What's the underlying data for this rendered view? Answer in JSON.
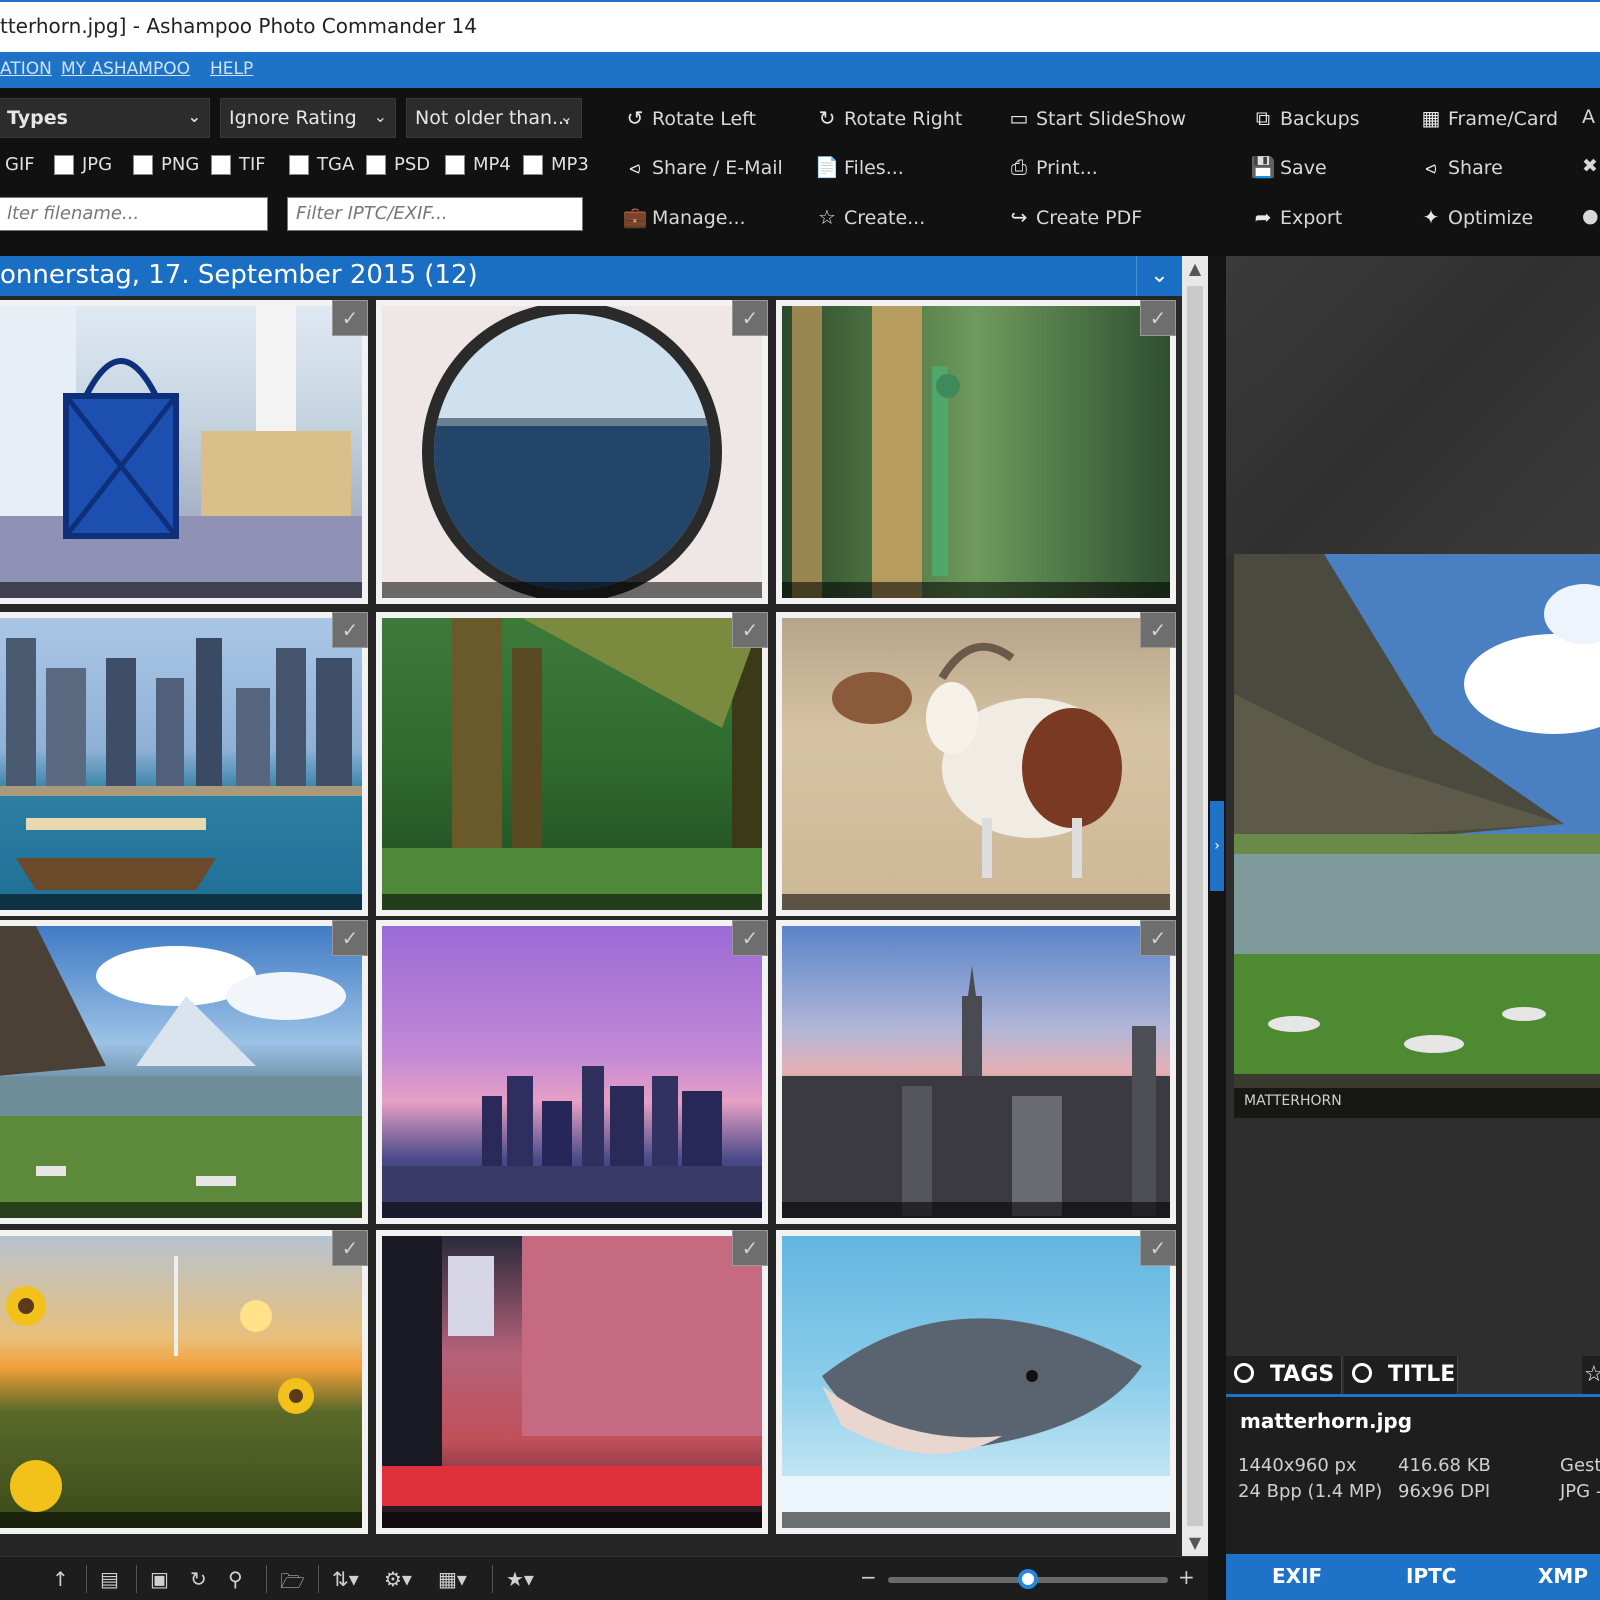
{
  "window": {
    "title": "tterhorn.jpg] - Ashampoo Photo Commander 14"
  },
  "menu": {
    "items": [
      "ATION",
      "MY ASHAMPOO",
      "HELP"
    ]
  },
  "filters": {
    "types": "Types",
    "rating": "Ignore Rating",
    "age": "Not older than...",
    "filetypes": [
      "GIF",
      "JPG",
      "PNG",
      "TIF",
      "TGA",
      "PSD",
      "MP4",
      "MP3"
    ],
    "filename_placeholder": "lter filename...",
    "iptc_placeholder": "Filter IPTC/EXIF..."
  },
  "toolbar": {
    "rotate_left": "Rotate Left",
    "rotate_right": "Rotate Right",
    "start_slideshow": "Start SlideShow",
    "share_email": "Share / E-Mail",
    "files": "Files...",
    "print": "Print...",
    "manage": "Manage...",
    "create": "Create...",
    "create_pdf": "Create PDF",
    "backups": "Backups",
    "frame_card": "Frame/Card",
    "save": "Save",
    "share": "Share",
    "export": "Export",
    "optimize": "Optimize"
  },
  "group": {
    "header": "onnerstag, 17. September 2015 (12)"
  },
  "thumbnails": [
    {
      "name": "lantern"
    },
    {
      "name": "porthole-sea"
    },
    {
      "name": "dragonfly"
    },
    {
      "name": "dubai-skyline"
    },
    {
      "name": "forest"
    },
    {
      "name": "goat"
    },
    {
      "name": "matterhorn"
    },
    {
      "name": "new-york-dusk"
    },
    {
      "name": "new-york-skyline"
    },
    {
      "name": "sunflowers"
    },
    {
      "name": "times-square"
    },
    {
      "name": "dolphin"
    }
  ],
  "preview": {
    "caption": "MATTERHORN",
    "tags_label": "TAGS",
    "title_label": "TITLE",
    "filename": "matterhorn.jpg",
    "dimensions": "1440x960 px",
    "bpp": "24 Bpp (1.4 MP)",
    "filesize": "416.68 KB",
    "dpi": "96x96 DPI",
    "col3_a": "Gest",
    "col3_b": "JPG -"
  },
  "meta_tabs": [
    "EXIF",
    "IPTC",
    "XMP"
  ],
  "zoom": {
    "minus": "−",
    "plus": "+",
    "level": 0.5
  },
  "colors": {
    "accent": "#1e73c8",
    "toolbar_bg": "#111111",
    "preview_bg": "#2e2e2e"
  }
}
